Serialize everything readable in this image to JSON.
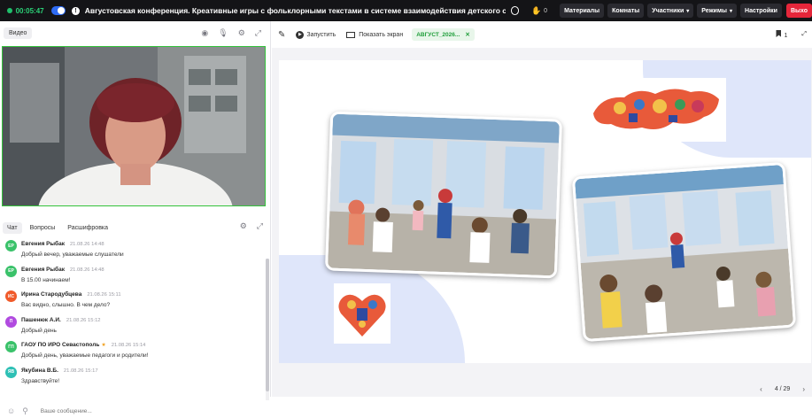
{
  "topbar": {
    "timer": "00:05:47",
    "title": "Августовская конференция. Креативные игры с фольклорными текстами в системе взаимодействия детского сад...",
    "hand_count": "0",
    "menu": [
      {
        "label": "Материалы"
      },
      {
        "label": "Комнаты"
      },
      {
        "label": "Участники"
      },
      {
        "label": "Режимы"
      },
      {
        "label": "Настройки"
      }
    ],
    "exit_label": "Выхо"
  },
  "video": {
    "label": "Видео"
  },
  "chat": {
    "tabs": [
      {
        "label": "Чат"
      },
      {
        "label": "Вопросы"
      },
      {
        "label": "Расшифровка"
      }
    ],
    "messages": [
      {
        "initials": "ЕР",
        "color": "#3ac26a",
        "author": "Евгения Рыбак",
        "time": "21.08.26 14:48",
        "text": "Добрый вечер, уважаемые слушатели"
      },
      {
        "initials": "ЕР",
        "color": "#3ac26a",
        "author": "Евгения Рыбак",
        "time": "21.08.26 14:48",
        "text": "В 15.00 начинаем!"
      },
      {
        "initials": "ИС",
        "color": "#f05a2a",
        "author": "Ирина Стародубцева",
        "time": "21.08.26 15:11",
        "text": "Вас видно, слышно. В чем дело?"
      },
      {
        "initials": "П",
        "color": "#b14be0",
        "author": "Пашенюк А.И.",
        "time": "21.08.26 15:12",
        "text": "Добрый день"
      },
      {
        "initials": "ГП",
        "color": "#3ac26a",
        "author": "ГАОУ ПО ИРО Севастополь",
        "time": "21.08.26 15:14",
        "text": "Добрый день, уважаемые педагоги и родители!"
      },
      {
        "initials": "ЯВ",
        "color": "#2ec0b5",
        "author": "Якубина В.Б.",
        "time": "21.08.26 15:17",
        "text": "Здравствуйте!"
      }
    ],
    "input_placeholder": "Ваше сообщение..."
  },
  "presentation": {
    "run_label": "Запустить",
    "screen_label": "Показать экран",
    "file_chip": "АВГУСТ_2026...",
    "bookmark_count": "1",
    "page": "4 / 29"
  },
  "colors": {
    "accent_green": "#34c23b",
    "exit_red": "#e5263a",
    "topbar_bg": "#141417",
    "toggle_blue": "#2f6cf5"
  }
}
